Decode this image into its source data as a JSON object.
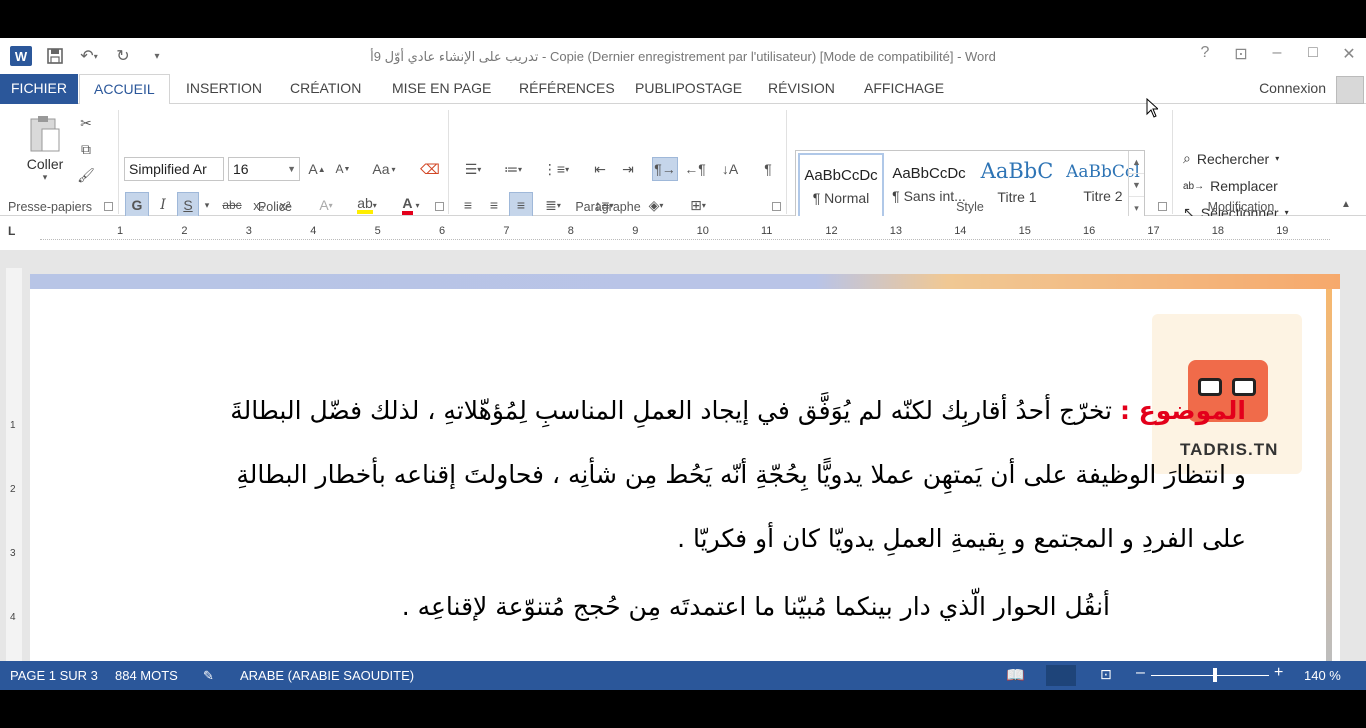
{
  "title_bar": {
    "window_title": "تدريب على الإنشاء عادي أوّل 9أ - Copie (Dernier enregistrement par l'utilisateur) [Mode de compatibilité] - Word",
    "qat_icons": [
      "word-icon",
      "save-icon",
      "undo-icon",
      "redo-icon",
      "customize-icon"
    ],
    "controls": [
      "help-icon",
      "ribbon-display-icon",
      "minimize-icon",
      "maximize-icon",
      "close-icon"
    ]
  },
  "tabs": {
    "file": "FICHIER",
    "items": [
      "ACCUEIL",
      "INSERTION",
      "CRÉATION",
      "MISE EN PAGE",
      "RÉFÉRENCES",
      "PUBLIPOSTAGE",
      "RÉVISION",
      "AFFICHAGE"
    ],
    "active": "ACCUEIL",
    "signin": "Connexion"
  },
  "ribbon": {
    "clipboard": {
      "paste_label": "Coller",
      "group": "Presse-papiers"
    },
    "font": {
      "family": "Simplified Ar",
      "size": "16",
      "bold": "G",
      "italic": "I",
      "underline": "S",
      "strike": "abc",
      "subscript": "x₂",
      "superscript": "x²",
      "case": "Aa",
      "group": "Police"
    },
    "paragraph": {
      "group": "Paragraphe"
    },
    "styles": {
      "items": [
        {
          "preview": "AaBbCcDc",
          "name": "¶ Normal"
        },
        {
          "preview": "AaBbCcDc",
          "name": "¶ Sans int..."
        },
        {
          "preview": "AaBbC",
          "name": "Titre 1"
        },
        {
          "preview": "AaBbCcl",
          "name": "Titre 2"
        }
      ],
      "group": "Style"
    },
    "editing": {
      "find": "Rechercher",
      "replace": "Remplacer",
      "select": "Sélectionner",
      "group": "Modification"
    }
  },
  "ruler": {
    "corner": "L",
    "numbers": [
      "1",
      "2",
      "3",
      "4",
      "5",
      "6",
      "7",
      "8",
      "9",
      "10",
      "11",
      "12",
      "13",
      "14",
      "15",
      "16",
      "17",
      "18",
      "19"
    ],
    "vertical_numbers": [
      "1",
      "2",
      "3",
      "4"
    ]
  },
  "document": {
    "subject_label": "الموضوع :",
    "line1": "تخرّج أحدُ أقاربِك لكنّه لم يُوَفَّق في إيجاد العملِ المناسبِ لِمُؤهّلاتهِ ، لذلك فضّل البطالةَ",
    "line2": "و انتظارَ الوظيفة على أن يَمتهِن عملا يدويًّا بِحُجّةِ أنّه يَحُط مِن شأنِه ، فحاولتَ إقناعه بأخطار البطالةِ",
    "line3": "على الفردِ و المجتمع و بِقيمةِ العملِ يدويّا كان أو فكريّا .",
    "line4": "أنقُل الحوار الّذي دار بينكما مُبيّنا ما اعتمدتَه مِن حُجج مُتنوّعة لإقناعِه .",
    "logo_text": "TADRIS.TN"
  },
  "status": {
    "page": "PAGE 1 SUR 3",
    "words": "884 MOTS",
    "language": "ARABE (ARABIE SAOUDITE)",
    "zoom": "140 %",
    "zoom_percent": 140
  },
  "colors": {
    "brand": "#2b579a",
    "subject": "#e3001b"
  }
}
